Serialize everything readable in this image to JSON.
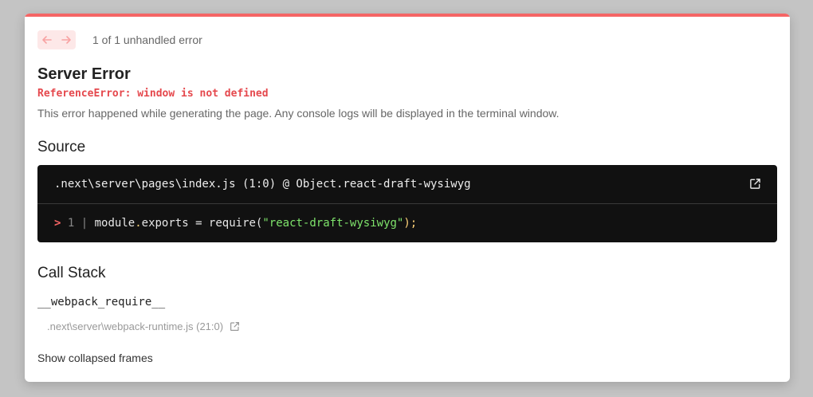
{
  "colors": {
    "accent": "#f56565",
    "error_text": "#e5484d",
    "code_bg": "#111111",
    "string": "#7ee36b"
  },
  "nav": {
    "prev_icon": "arrow-left-icon",
    "next_icon": "arrow-right-icon",
    "count_label": "1 of 1 unhandled error"
  },
  "header": {
    "title": "Server Error",
    "error_message": "ReferenceError: window is not defined",
    "description": "This error happened while generating the page. Any console logs will be displayed in the terminal window."
  },
  "source": {
    "heading": "Source",
    "file_location": ".next\\server\\pages\\index.js (1:0) @ Object.react-draft-wysiwyg",
    "open_icon": "external-link-icon",
    "line_marker": ">",
    "line_number": "1",
    "separator": "|",
    "code_prefix": "module",
    "code_dot": ".",
    "code_exports": "exports = require(",
    "code_string": "\"react-draft-wysiwyg\"",
    "code_suffix": ");"
  },
  "call_stack": {
    "heading": "Call Stack",
    "frames": [
      {
        "function": "__webpack_require__",
        "file": ".next\\server\\webpack-runtime.js (21:0)",
        "icon": "external-link-icon"
      }
    ],
    "show_collapsed_label": "Show collapsed frames"
  }
}
